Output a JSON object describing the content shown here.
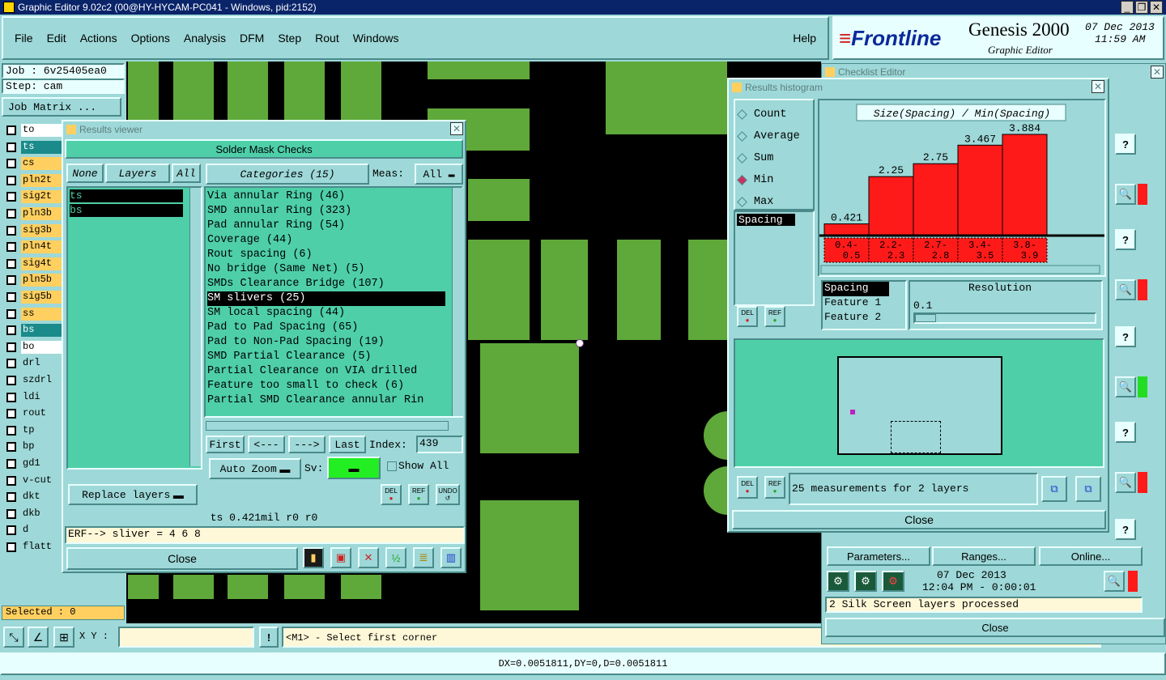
{
  "window": {
    "title": "Graphic Editor 9.02c2 (00@HY-HYCAM-PC041 - Windows, pid:2152)"
  },
  "menu": [
    "File",
    "Edit",
    "Actions",
    "Options",
    "Analysis",
    "DFM",
    "Step",
    "Rout",
    "Windows"
  ],
  "help": "Help",
  "brand": {
    "logo": "Frontline",
    "product": "Genesis 2000",
    "subtitle": "Graphic Editor",
    "date": "07 Dec 2013",
    "time": "11:59 AM"
  },
  "job": {
    "job": "Job : 6v25405ea0",
    "step": "Step: cam",
    "matrix": "Job Matrix ..."
  },
  "layers": [
    {
      "name": "to",
      "color": "#ffffff"
    },
    {
      "name": "ts",
      "color": "#1a8a8a"
    },
    {
      "name": "cs",
      "color": "#ffd060"
    },
    {
      "name": "pln2t",
      "color": "#ffd060"
    },
    {
      "name": "sig2t",
      "color": "#ffd060"
    },
    {
      "name": "pln3b",
      "color": "#ffd060"
    },
    {
      "name": "sig3b",
      "color": "#ffd060"
    },
    {
      "name": "pln4t",
      "color": "#ffd060"
    },
    {
      "name": "sig4t",
      "color": "#ffd060"
    },
    {
      "name": "pln5b",
      "color": "#ffd060"
    },
    {
      "name": "sig5b",
      "color": "#ffd060"
    },
    {
      "name": "ss",
      "color": "#ffd060"
    },
    {
      "name": "bs",
      "color": "#1a8a8a"
    },
    {
      "name": "bo",
      "color": "#ffffff"
    },
    {
      "name": "drl",
      "color": "#9ed8d8"
    },
    {
      "name": "szdrl",
      "color": "#9ed8d8"
    },
    {
      "name": "ldi",
      "color": "#9ed8d8"
    },
    {
      "name": "rout",
      "color": "#9ed8d8"
    },
    {
      "name": "tp",
      "color": "#9ed8d8"
    },
    {
      "name": "bp",
      "color": "#9ed8d8"
    },
    {
      "name": "gd1",
      "color": "#9ed8d8"
    },
    {
      "name": "v-cut",
      "color": "#9ed8d8"
    },
    {
      "name": "dkt",
      "color": "#9ed8d8"
    },
    {
      "name": "dkb",
      "color": "#9ed8d8"
    },
    {
      "name": "d",
      "color": "#9ed8d8"
    },
    {
      "name": "flatt",
      "color": "#9ed8d8"
    }
  ],
  "selected": "Selected : 0",
  "results_viewer": {
    "title": "Results viewer",
    "header": "Solder Mask Checks",
    "none": "None",
    "layers_label": "Layers",
    "all": "All",
    "categories": "Categories (15)",
    "meas_label": "Meas:",
    "meas_value": "All",
    "layers": [
      "ts",
      "bs"
    ],
    "items": [
      "Via annular Ring (46)",
      "SMD annular Ring (323)",
      "Pad annular Ring (54)",
      "Coverage (44)",
      "Rout spacing (6)",
      "No bridge (Same Net) (5)",
      "SMDs Clearance Bridge (107)",
      "SM slivers (25)",
      "SM local spacing (44)",
      "Pad to Pad Spacing (65)",
      "Pad to Non-Pad Spacing (19)",
      "SMD Partial Clearance (5)",
      "Partial Clearance on VIA drilled",
      "Feature too small to check (6)",
      "Partial SMD Clearance annular Rin"
    ],
    "nav": [
      "First",
      "<---",
      "--->",
      "Last"
    ],
    "index_label": "Index:",
    "index_value": "439",
    "auto_zoom": "Auto Zoom",
    "sv": "Sv:",
    "show_all": "Show All",
    "replace": "Replace layers",
    "del": "DEL",
    "ref": "REF",
    "undo": "UNDO",
    "status": "ts 0.421mil  r0  r0",
    "erf": "ERF--> sliver = 4 6 8",
    "close": "Close"
  },
  "checklist": {
    "title": "Checklist Editor",
    "parameters": "Parameters...",
    "ranges": "Ranges...",
    "online": "Online...",
    "date": "07 Dec 2013",
    "time": "12:04 PM - 0:00:01",
    "status": "2 Silk Screen layers processed",
    "close": "Close"
  },
  "histogram": {
    "title": "Results histogram",
    "options": [
      "Count",
      "Average",
      "Sum",
      "Min",
      "Max"
    ],
    "selected": "Min",
    "chart_title": "Size(Spacing) / Min(Spacing)",
    "list": [
      "Spacing"
    ],
    "features": [
      "Spacing",
      "Feature 1",
      "Feature 2"
    ],
    "resolution_label": "Resolution",
    "resolution_value": "0.1",
    "summary": "25 measurements for 2 layers",
    "close": "Close",
    "del": "DEL",
    "ref": "REF"
  },
  "chart_data": {
    "type": "bar",
    "title": "Size(Spacing) / Min(Spacing)",
    "categories": [
      "0.4-0.5",
      "2.2-2.3",
      "2.7-2.8",
      "3.4-3.5",
      "3.8-3.9"
    ],
    "category_lines": [
      [
        "0.4-",
        "0.5"
      ],
      [
        "2.2-",
        "2.3"
      ],
      [
        "2.7-",
        "2.8"
      ],
      [
        "3.4-",
        "3.5"
      ],
      [
        "3.8-",
        "3.9"
      ]
    ],
    "values": [
      0.421,
      2.25,
      2.75,
      3.467,
      3.884
    ],
    "value_labels": [
      "0.421",
      "2.25",
      "2.75",
      "3.467",
      "3.884"
    ],
    "ylim": [
      0,
      3.884
    ],
    "bar_color": "#ff1a1a"
  },
  "bottom": {
    "xy_label": "X Y :",
    "prompt": "<M1> - Select first corner",
    "measure": "DX=0.0051811,DY=0,D=0.0051811"
  }
}
